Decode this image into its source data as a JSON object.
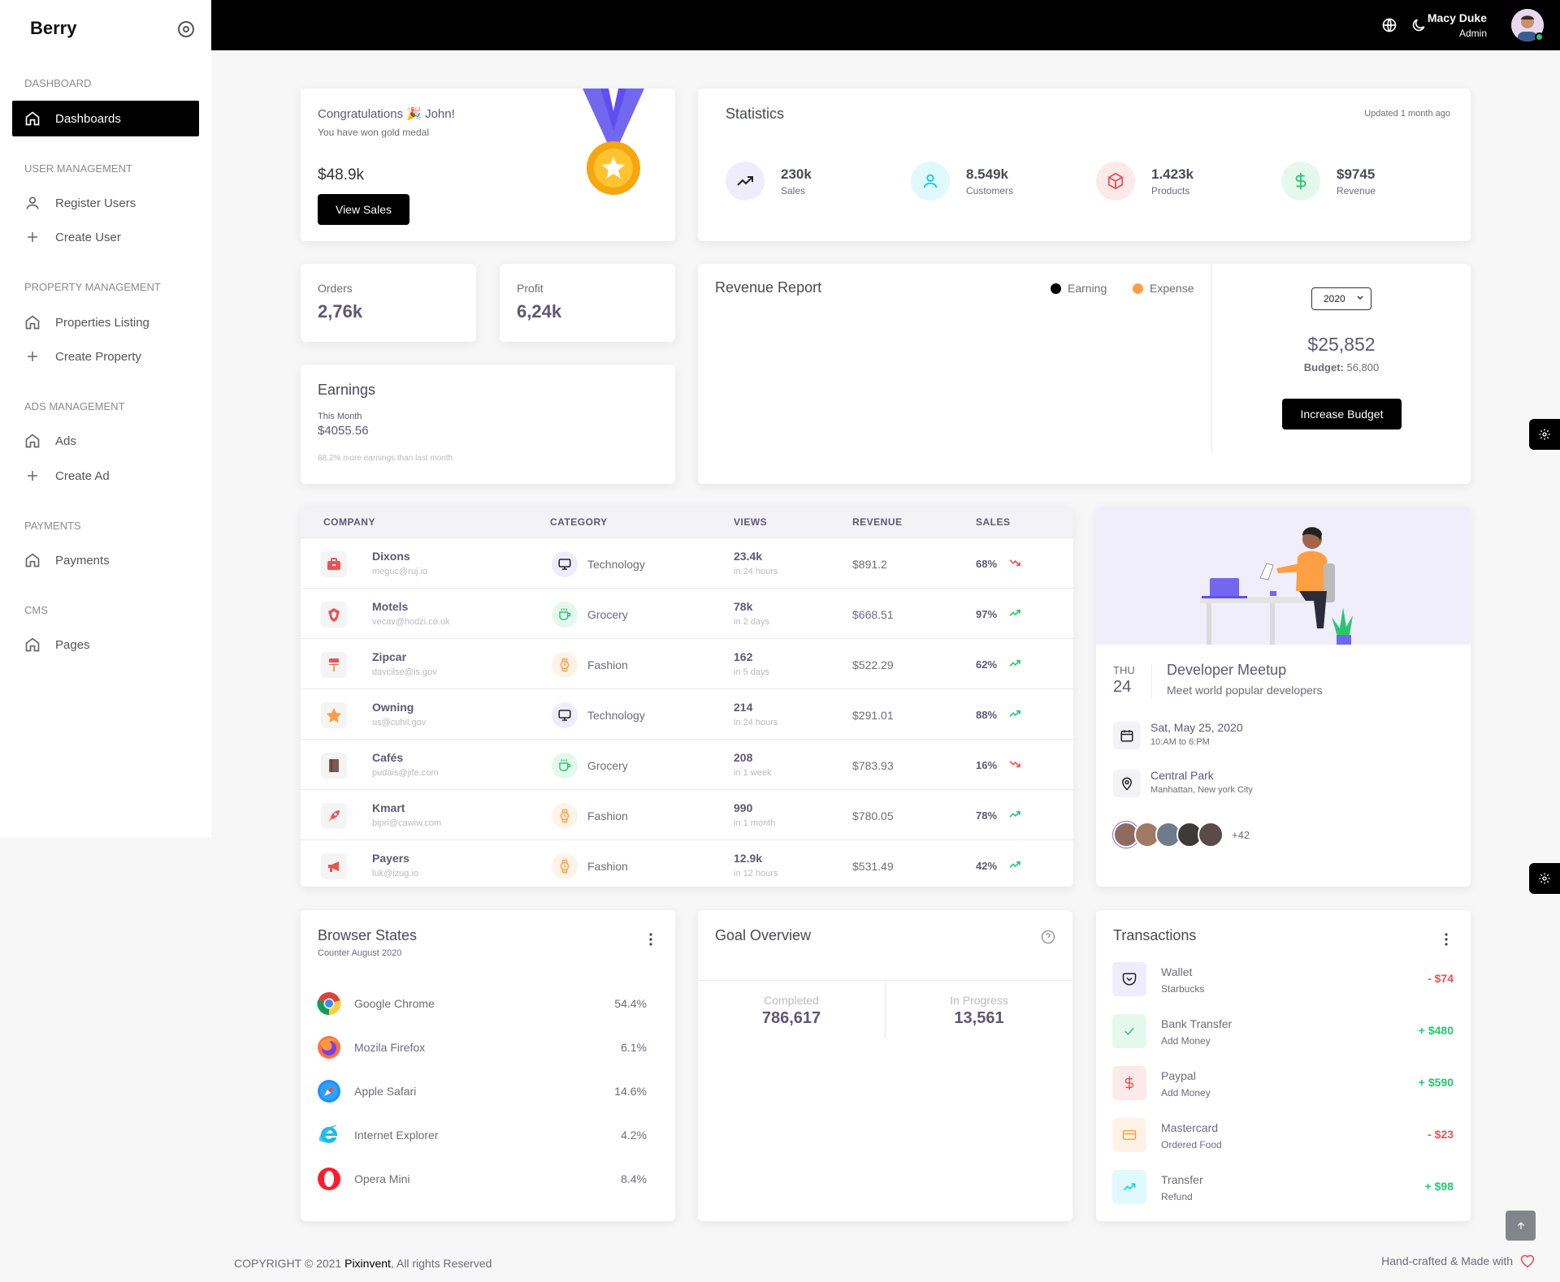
{
  "sidebar": {
    "brand": "Berry",
    "sections": [
      {
        "title": "DASHBOARD",
        "items": [
          {
            "label": "Dashboards",
            "icon": "home-icon",
            "active": true
          }
        ]
      },
      {
        "title": "USER MANAGEMENT",
        "items": [
          {
            "label": "Register Users",
            "icon": "user-icon"
          },
          {
            "label": "Create User",
            "icon": "plus-icon"
          }
        ]
      },
      {
        "title": "PROPERTY MANAGEMENT",
        "items": [
          {
            "label": "Properties Listing",
            "icon": "home-icon"
          },
          {
            "label": "Create Property",
            "icon": "plus-icon"
          }
        ]
      },
      {
        "title": "ADS MANAGEMENT",
        "items": [
          {
            "label": "Ads",
            "icon": "home-icon"
          },
          {
            "label": "Create Ad",
            "icon": "plus-icon"
          }
        ]
      },
      {
        "title": "PAYMENTS",
        "items": [
          {
            "label": "Payments",
            "icon": "home-icon"
          }
        ]
      },
      {
        "title": "CMS",
        "items": [
          {
            "label": "Pages",
            "icon": "home-icon"
          }
        ]
      }
    ]
  },
  "topbar": {
    "user_name": "Macy Duke",
    "user_role": "Admin"
  },
  "congrats": {
    "title": "Congratulations 🎉 John!",
    "subtitle": "You have won gold medal",
    "amount": "$48.9k",
    "button": "View Sales"
  },
  "statistics": {
    "title": "Statistics",
    "updated": "Updated 1 month ago",
    "items": [
      {
        "value": "230k",
        "label": "Sales",
        "icon": "trending-up-icon",
        "color": "#7367f0"
      },
      {
        "value": "8.549k",
        "label": "Customers",
        "icon": "user-icon",
        "color": "#00cfe8"
      },
      {
        "value": "1.423k",
        "label": "Products",
        "icon": "box-icon",
        "color": "#ea5455"
      },
      {
        "value": "$9745",
        "label": "Revenue",
        "icon": "dollar-icon",
        "color": "#28c76f"
      }
    ]
  },
  "orders": {
    "label": "Orders",
    "value": "2,76k"
  },
  "profit": {
    "label": "Profit",
    "value": "6,24k"
  },
  "earnings": {
    "title": "Earnings",
    "period": "This Month",
    "amount": "$4055.56",
    "note": "68.2% more earnings than last month."
  },
  "revenue_report": {
    "title": "Revenue Report",
    "legend": [
      {
        "label": "Earning",
        "color": "#000000"
      },
      {
        "label": "Expense",
        "color": "#ff9f43"
      }
    ],
    "year": "2020",
    "amount": "$25,852",
    "budget_label": "Budget:",
    "budget_value": "56,800",
    "button": "Increase Budget"
  },
  "company_table": {
    "headers": [
      "COMPANY",
      "CATEGORY",
      "VIEWS",
      "REVENUE",
      "SALES"
    ],
    "rows": [
      {
        "name": "Dixons",
        "email": "meguc@ruj.io",
        "category": "Technology",
        "views": "23.4k",
        "time": "in 24 hours",
        "revenue": "$891.2",
        "sales": "68%",
        "trend": "down"
      },
      {
        "name": "Motels",
        "email": "vecav@hodzi.co.uk",
        "category": "Grocery",
        "views": "78k",
        "time": "in 2 days",
        "revenue": "$668.51",
        "sales": "97%",
        "trend": "up"
      },
      {
        "name": "Zipcar",
        "email": "davcilse@is.gov",
        "category": "Fashion",
        "views": "162",
        "time": "in 5 days",
        "revenue": "$522.29",
        "sales": "62%",
        "trend": "up"
      },
      {
        "name": "Owning",
        "email": "us@cuhil.gov",
        "category": "Technology",
        "views": "214",
        "time": "in 24 hours",
        "revenue": "$291.01",
        "sales": "88%",
        "trend": "up"
      },
      {
        "name": "Cafés",
        "email": "pudais@jife.com",
        "category": "Grocery",
        "views": "208",
        "time": "in 1 week",
        "revenue": "$783.93",
        "sales": "16%",
        "trend": "down"
      },
      {
        "name": "Kmart",
        "email": "bipri@cawiw.com",
        "category": "Fashion",
        "views": "990",
        "time": "in 1 month",
        "revenue": "$780.05",
        "sales": "78%",
        "trend": "up"
      },
      {
        "name": "Payers",
        "email": "luk@izug.io",
        "category": "Fashion",
        "views": "12.9k",
        "time": "in 12 hours",
        "revenue": "$531.49",
        "sales": "42%",
        "trend": "up"
      }
    ]
  },
  "meetup": {
    "day": "THU",
    "date": "24",
    "title": "Developer Meetup",
    "subtitle": "Meet world popular developers",
    "when": "Sat, May 25, 2020",
    "when_sub": "10:AM to 6:PM",
    "where": "Central Park",
    "where_sub": "Manhattan, New york City",
    "more": "+42"
  },
  "browser_states": {
    "title": "Browser States",
    "subtitle": "Counter August 2020",
    "items": [
      {
        "name": "Google Chrome",
        "pct": "54.4%",
        "icon": "chrome-icon"
      },
      {
        "name": "Mozila Firefox",
        "pct": "6.1%",
        "icon": "firefox-icon"
      },
      {
        "name": "Apple Safari",
        "pct": "14.6%",
        "icon": "safari-icon"
      },
      {
        "name": "Internet Explorer",
        "pct": "4.2%",
        "icon": "ie-icon"
      },
      {
        "name": "Opera Mini",
        "pct": "8.4%",
        "icon": "opera-icon"
      }
    ]
  },
  "goal": {
    "title": "Goal Overview",
    "completed_label": "Completed",
    "completed": "786,617",
    "progress_label": "In Progress",
    "progress": "13,561"
  },
  "transactions": {
    "title": "Transactions",
    "items": [
      {
        "name": "Wallet",
        "sub": "Starbucks",
        "amount": "- $74",
        "color": "#ea5455",
        "icon": "pocket-icon"
      },
      {
        "name": "Bank Transfer",
        "sub": "Add Money",
        "amount": "+ $480",
        "color": "#28c76f",
        "icon": "check-icon"
      },
      {
        "name": "Paypal",
        "sub": "Add Money",
        "amount": "+ $590",
        "color": "#28c76f",
        "icon": "dollar-icon"
      },
      {
        "name": "Mastercard",
        "sub": "Ordered Food",
        "amount": "- $23",
        "color": "#ea5455",
        "icon": "credit-card-icon"
      },
      {
        "name": "Transfer",
        "sub": "Refund",
        "amount": "+ $98",
        "color": "#28c76f",
        "icon": "trending-up-icon"
      }
    ]
  },
  "footer": {
    "copyright": "COPYRIGHT © 2021",
    "company": "Pixinvent",
    "rights": ", All rights Reserved",
    "made": "Hand-crafted & Made with"
  }
}
